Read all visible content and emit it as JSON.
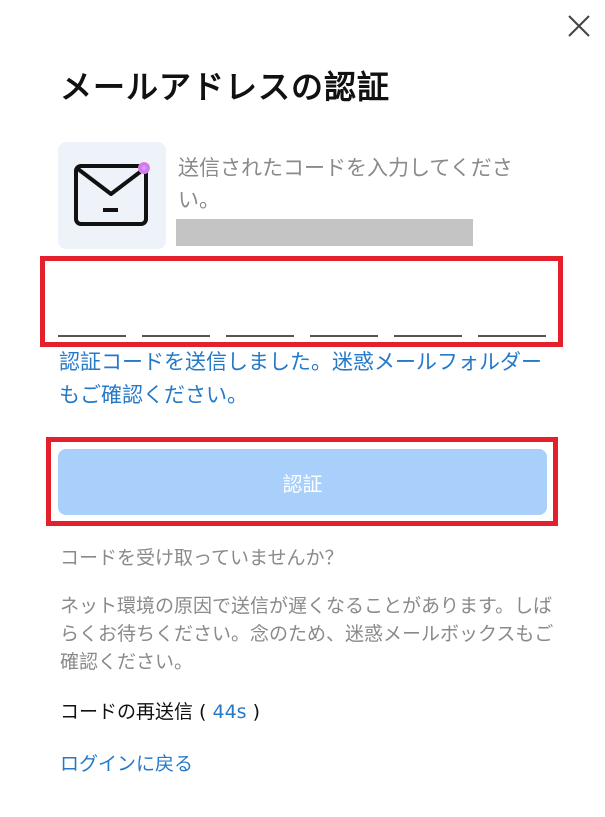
{
  "dialog": {
    "title": "メールアドレスの認証",
    "instruction": "送信されたコードを入力してください。",
    "code_slot_count": 6,
    "sent_notice": "認証コードを送信しました。迷惑メールフォルダーもご確認ください。",
    "verify_button_label": "認証",
    "no_code_heading": "コードを受け取っていませんか？",
    "network_note": "ネット環境の原因で送信が遅くなることがあります。しばらくお待ちください。念のため、迷惑メールボックスもご確認ください。",
    "resend": {
      "label": "コードの再送信 (",
      "timer": "44s",
      "suffix": ")"
    },
    "back_to_login": "ログインに戻る"
  },
  "icons": {
    "close": "close-icon",
    "mail": "envelope-icon"
  },
  "colors": {
    "link": "#2479c9",
    "button_disabled": "#a8d0fb",
    "highlight_frame": "#e3202b",
    "muted_text": "#8a8a8a",
    "redacted": "#c4c4c4"
  }
}
